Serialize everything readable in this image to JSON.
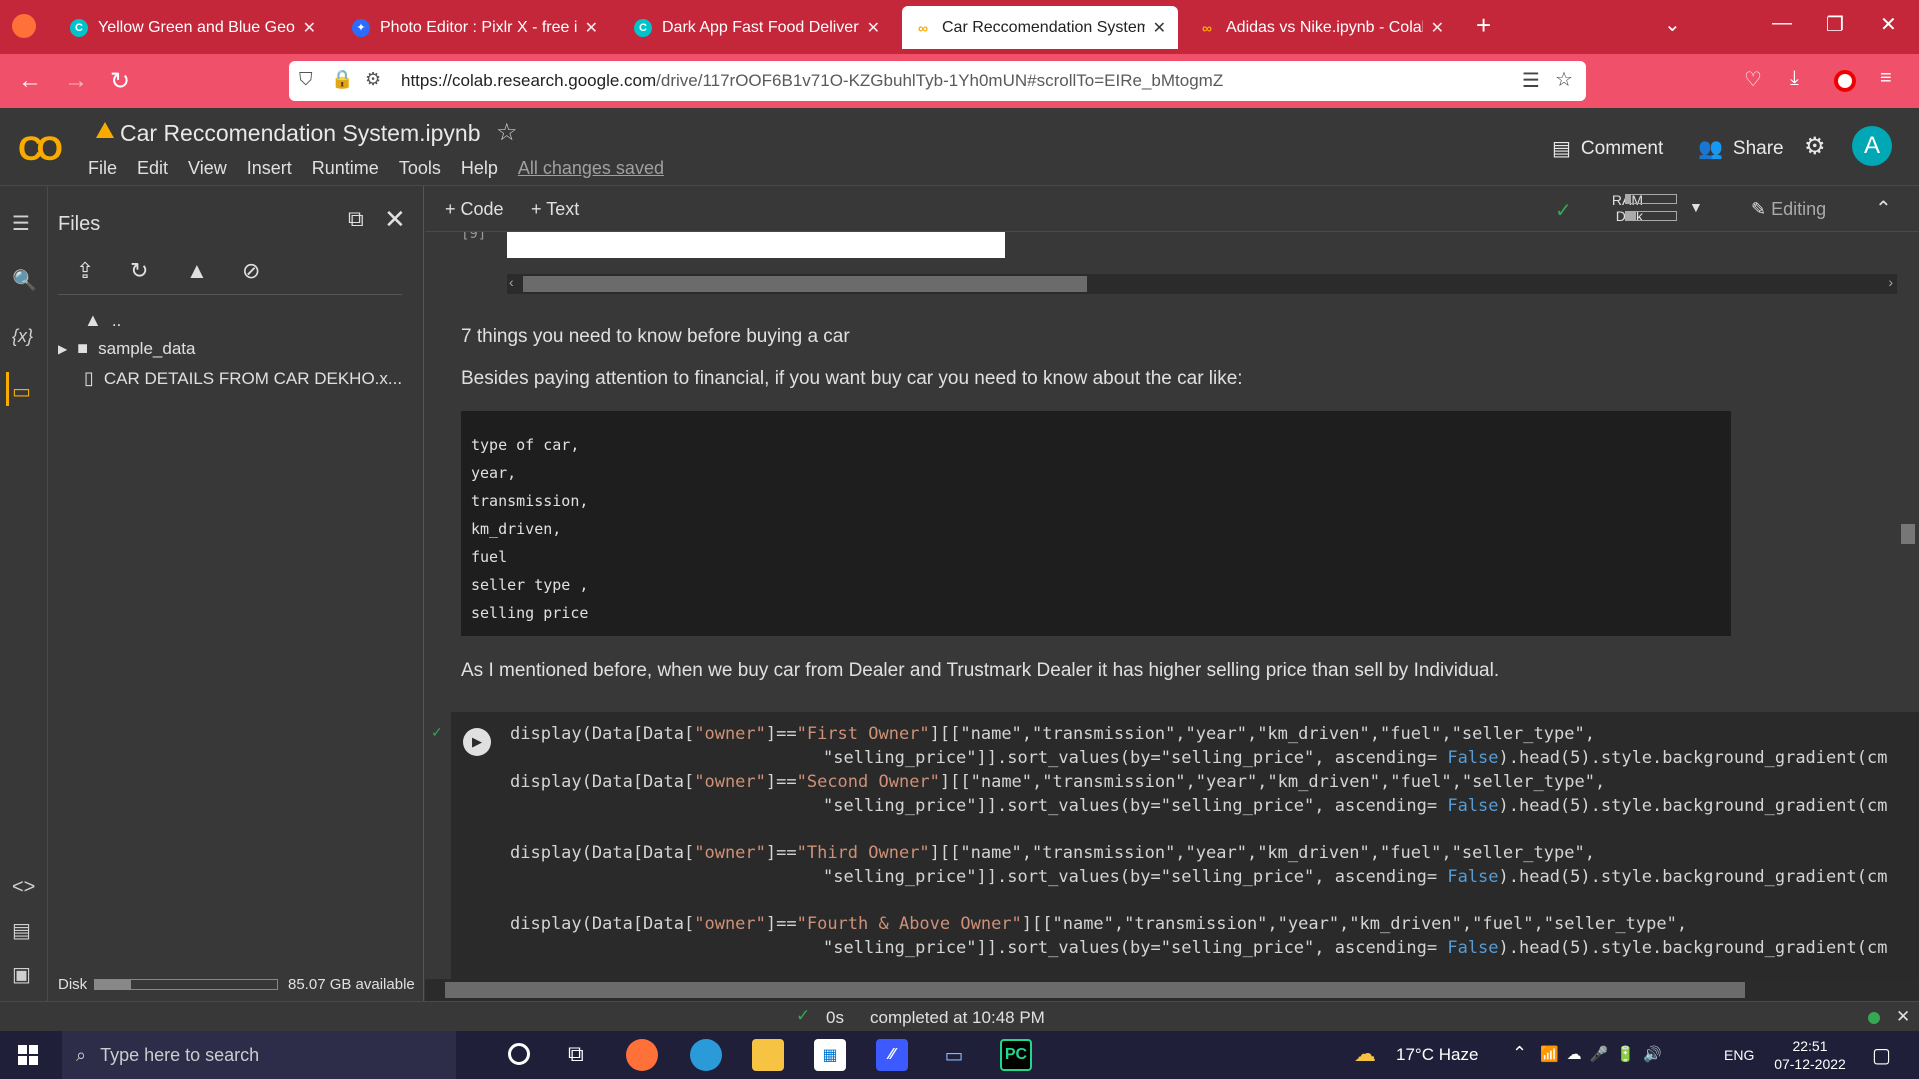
{
  "browser": {
    "tabs": [
      {
        "label": "Yellow Green and Blue Geometr",
        "favicon": "canva-icon"
      },
      {
        "label": "Photo Editor : Pixlr X - free imag",
        "favicon": "pixlr-icon"
      },
      {
        "label": "Dark App Fast Food Delivery Ins",
        "favicon": "canva-icon"
      },
      {
        "label": "Car Reccomendation System.ipy",
        "favicon": "colab-icon",
        "active": true
      },
      {
        "label": "Adidas vs Nike.ipynb - Colabora",
        "favicon": "colab-icon"
      }
    ],
    "url_domain": "https://colab.research.google.com",
    "url_path": "/drive/117rOOF6B1v71O-KZGbuhlTyb-1Yh0mUN#scrollTo=EIRe_bMtogmZ"
  },
  "colab": {
    "notebook_title": "Car Reccomendation System.ipynb",
    "menus": [
      "File",
      "Edit",
      "View",
      "Insert",
      "Runtime",
      "Tools",
      "Help"
    ],
    "save_status": "All changes saved",
    "comment_label": "Comment",
    "share_label": "Share",
    "avatar_letter": "A",
    "add_code": "Code",
    "add_text": "Text",
    "ram_label": "RAM",
    "disk_label": "Disk",
    "editing_label": "Editing"
  },
  "files": {
    "title": "Files",
    "items": [
      {
        "name": ".."
      },
      {
        "name": "sample_data"
      },
      {
        "name": "CAR DETAILS FROM CAR DEKHO.x..."
      }
    ],
    "disk_label": "Disk",
    "disk_available": "85.07 GB available",
    "disk_used_fraction": 0.2
  },
  "notebook": {
    "prev_cell_counter": "[9]",
    "heading": "7 things you need to know before buying a car",
    "intro": "Besides paying attention to financial, if you want buy car you need to know about the car like:",
    "code_list": [
      "type of car,",
      "year,",
      "transmission,",
      "km_driven,",
      "fuel",
      "seller type ,",
      "selling price"
    ],
    "dealer_note": "As I mentioned before, when we buy car from Dealer and Trustmark Dealer it has higher selling price than sell by Individual.",
    "code_lines": [
      {
        "owner": "\"First Owner\""
      },
      {
        "owner": "\"Second Owner\""
      },
      {
        "owner": "\"Third Owner\""
      },
      {
        "owner": "\"Fourth & Above Owner\""
      }
    ],
    "code_prefix": "display(Data[Data[",
    "code_owner_key": "\"owner\"",
    "code_mid": "]==",
    "code_cols": "][[\"name\",\"transmission\",\"year\",\"km_driven\",\"fuel\",\"seller_type\",",
    "code_cont_a": "\"selling_price\"]].sort_values(by=\"selling_price\", ascending= ",
    "code_false": "False",
    "code_cont_b": ").head(5).style.background_gradient(cm"
  },
  "status": {
    "duration": "0s",
    "message": "completed at 10:48 PM"
  },
  "taskbar": {
    "search_placeholder": "Type here to search",
    "weather": "17°C  Haze",
    "language": "ENG",
    "time": "22:51",
    "date": "07-12-2022"
  }
}
